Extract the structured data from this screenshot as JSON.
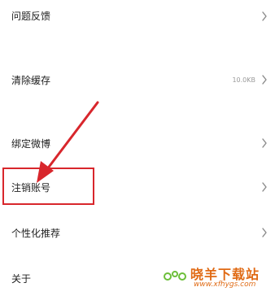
{
  "settings": {
    "items": [
      {
        "label": "问题反馈",
        "value": ""
      },
      {
        "label": "清除缓存",
        "value": "10.0KB"
      },
      {
        "label": "绑定微博",
        "value": ""
      },
      {
        "label": "注销账号",
        "value": ""
      },
      {
        "label": "个性化推荐",
        "value": ""
      },
      {
        "label": "关于",
        "value": ""
      }
    ]
  },
  "annotation": {
    "color": "#d8262c"
  },
  "watermark": {
    "title": "晓羊下载站",
    "url": "www.xfhygs.com",
    "color": "#e06a14"
  }
}
